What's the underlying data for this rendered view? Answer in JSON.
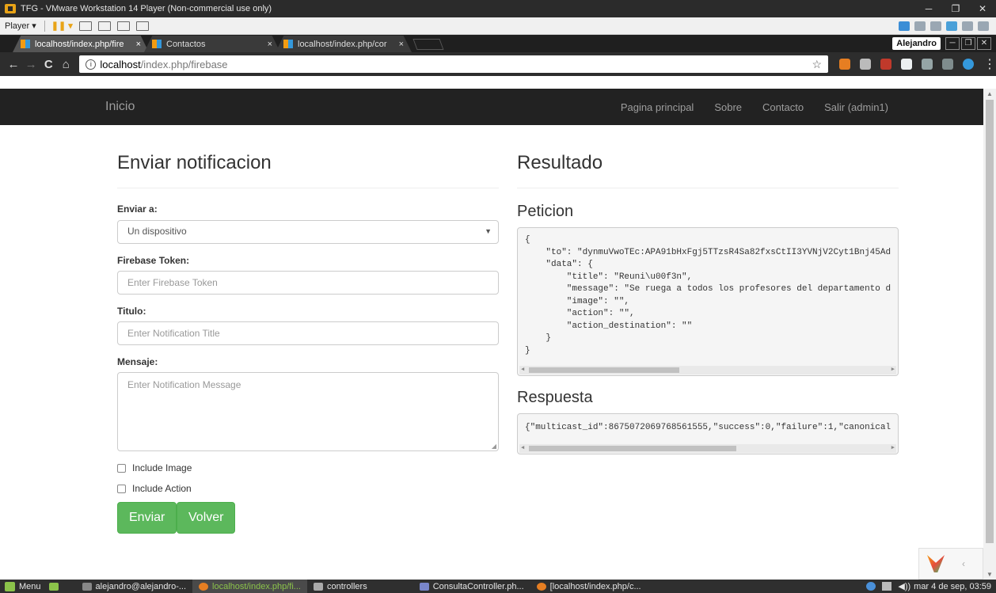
{
  "vm": {
    "title": "TFG - VMware Workstation 14 Player (Non-commercial use only)",
    "player_label": "Player ▾",
    "minimize": "─",
    "restore": "❐",
    "close": "✕"
  },
  "browser": {
    "tabs": [
      {
        "label": "localhost/index.php/fire",
        "close": "×"
      },
      {
        "label": "Contactos",
        "close": "×"
      },
      {
        "label": "localhost/index.php/cor",
        "close": "×"
      }
    ],
    "profile": "Alejandro",
    "win_min": "─",
    "win_restore": "❐",
    "win_close": "✕",
    "back": "←",
    "forward": "→",
    "reload": "C",
    "home": "⌂",
    "url_host": "localhost",
    "url_path": "/index.php/firebase",
    "info_icon": "i",
    "star": "☆",
    "menu": "⋮"
  },
  "site": {
    "brand": "Inicio",
    "nav": [
      "Pagina principal",
      "Sobre",
      "Contacto",
      "Salir (admin1)"
    ]
  },
  "form": {
    "heading": "Enviar notificacion",
    "send_to_label": "Enviar a:",
    "send_to_value": "Un dispositivo",
    "token_label": "Firebase Token:",
    "token_placeholder": "Enter Firebase Token",
    "title_label": "Titulo:",
    "title_placeholder": "Enter Notification Title",
    "message_label": "Mensaje:",
    "message_placeholder": "Enter Notification Message",
    "include_image": "Include Image",
    "include_action": "Include Action",
    "send_button": "Enviar",
    "back_button": "Volver"
  },
  "result": {
    "heading": "Resultado",
    "request_heading": "Peticion",
    "request_body": "{\n    \"to\": \"dynmuVwoTEc:APA91bHxFgj5TTzsR4Sa82fxsCtII3YVNjV2Cyt1Bnj45Ad\n    \"data\": {\n        \"title\": \"Reuni\\u00f3n\",\n        \"message\": \"Se ruega a todos los profesores del departamento d\n        \"image\": \"\",\n        \"action\": \"\",\n        \"action_destination\": \"\"\n    }\n}",
    "response_heading": "Respuesta",
    "response_body": "{\"multicast_id\":8675072069768561555,\"success\":0,\"failure\":1,\"canonical",
    "request_scroll_fraction": 0.42,
    "response_scroll_fraction": 0.58
  },
  "taskbar": {
    "menu": "Menu",
    "items": [
      "alejandro@alejandro-...",
      "localhost/index.php/fi...",
      "controllers",
      "ConsultaController.ph...",
      "[localhost/index.php/c..."
    ],
    "clock": "mar 4 de sep, 03:59",
    "volume": "◀))"
  },
  "colors": {
    "success": "#5cb85c",
    "navbar": "#222222",
    "accent": "#8bc34a"
  }
}
